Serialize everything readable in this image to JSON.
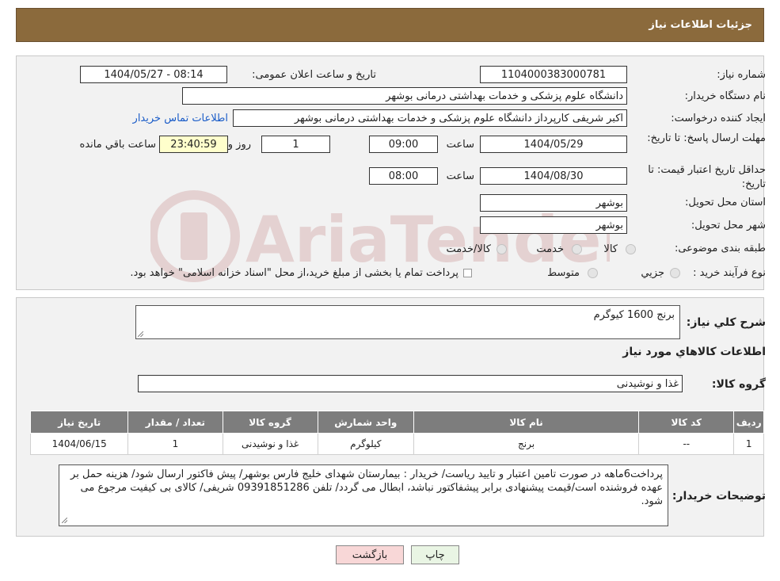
{
  "header": {
    "title": "جزئیات اطلاعات نیاز"
  },
  "form": {
    "need_number_label": "شماره نیاز:",
    "need_number": "1104000383000781",
    "announce_label": "تاریخ و ساعت اعلان عمومی:",
    "announce_value": "1404/05/27 - 08:14",
    "buyer_org_label": "نام دستگاه خریدار:",
    "buyer_org": "دانشگاه علوم پزشکی و خدمات بهداشتی درمانی بوشهر",
    "creator_label": "ایجاد کننده درخواست:",
    "creator": "اکبر شریفی کارپرداز دانشگاه علوم پزشکی و خدمات بهداشتی درمانی بوشهر",
    "contact_link": "اطلاعات تماس خریدار",
    "deadline_label": "مهلت ارسال پاسخ: تا تاریخ:",
    "deadline_date": "1404/05/29",
    "time_label": "ساعت",
    "deadline_time": "09:00",
    "days": "1",
    "days_label": "روز و",
    "remaining": "23:40:59",
    "remaining_label": "ساعت باقي مانده",
    "validity_label": "حداقل تاریخ اعتبار قیمت: تا تاریخ:",
    "validity_date": "1404/08/30",
    "validity_time": "08:00",
    "province_label": "استان محل تحویل:",
    "province": "بوشهر",
    "city_label": "شهر محل تحویل:",
    "city": "بوشهر",
    "category_label": "طبقه بندی موضوعی:",
    "category_options": [
      "کالا",
      "خدمت",
      "کالا/خدمت"
    ],
    "process_label": "نوع فرآیند خرید :",
    "process_options": [
      "جزيي",
      "متوسط"
    ],
    "process_note": "پرداخت تمام یا بخشی از مبلغ خرید،از محل \"اسناد خزانه اسلامی\" خواهد بود."
  },
  "details": {
    "summary_label": "شرح کلي نياز:",
    "summary": "برنج 1600 کیوگرم",
    "goods_info_title": "اطلاعات كالاهاي مورد نياز",
    "group_label": "گروه کالا:",
    "group": "غذا و نوشیدنی",
    "table": {
      "headers": [
        "رديف",
        "کد کالا",
        "نام کالا",
        "واحد شمارش",
        "گروه کالا",
        "تعداد / مقدار",
        "تاريخ نياز"
      ],
      "rows": [
        [
          "1",
          "--",
          "برنج",
          "کیلوگرم",
          "غذا و نوشیدنی",
          "1",
          "1404/06/15"
        ]
      ]
    },
    "buyer_notes_label": "توضیحات خریدار:",
    "buyer_notes": "پرداخت6ماهه در صورت تامین اعتبار و تایید ریاست/ خریدار : بیمارستان شهدای خلیج فارس بوشهر/ پیش فاکتور ارسال شود/ هزینه حمل بر عهده فروشنده است/قیمت پیشنهادی برابر پیشفاکتور نباشد، ابطال می گردد/ تلفن 09391851286 شریفی/ کالای بی کیفیت مرجوع می شود."
  },
  "buttons": {
    "print": "چاپ",
    "back": "بازگشت"
  },
  "watermark": {
    "text": "AriaTender.neT"
  },
  "colors": {
    "header_bg": "#8b6a3c",
    "back_button_bg": "#f8d7d7",
    "print_button_bg": "#e9f5e4",
    "remaining_bg": "#ffffcc"
  }
}
